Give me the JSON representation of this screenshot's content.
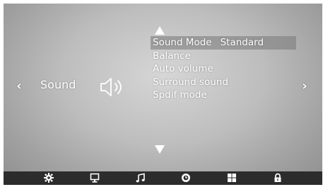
{
  "category": {
    "label": "Sound",
    "icon": "speaker-icon"
  },
  "nav": {
    "left": "‹",
    "right": "›"
  },
  "menu": {
    "items": [
      {
        "label": "Sound Mode",
        "value": "Standard",
        "selected": true
      },
      {
        "label": "Balance"
      },
      {
        "label": "Auto volume"
      },
      {
        "label": "Surround sound"
      },
      {
        "label": "Spdif mode"
      }
    ]
  },
  "bottom_bar": {
    "icons": [
      "settings-gear-icon",
      "monitor-icon",
      "music-note-icon",
      "clock-icon",
      "grid-icon",
      "lock-icon"
    ]
  },
  "colors": {
    "bottom_bar_bg": "#2c2c2c",
    "text": "#ffffff",
    "selected_bg": "#7a7a7a"
  }
}
